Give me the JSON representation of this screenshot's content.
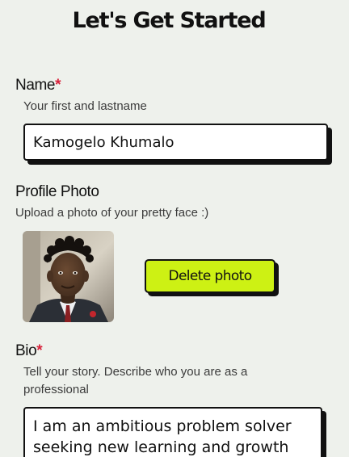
{
  "header": {
    "title": "Let's Get Started"
  },
  "name_field": {
    "label": "Name",
    "required_mark": "*",
    "helper": "Your first and lastname",
    "value": "Kamogelo Khumalo"
  },
  "photo_field": {
    "label": "Profile Photo",
    "helper": "Upload a photo of your pretty face :)",
    "delete_label": "Delete photo",
    "accent_color": "#cdf114"
  },
  "bio_field": {
    "label": "Bio",
    "required_mark": "*",
    "helper": "Tell your story. Describe who you are as a professional",
    "value": "I am an ambitious problem solver seeking new learning and growth"
  },
  "colors": {
    "background": "#eef1ec",
    "required": "#d8223b",
    "border": "#111111"
  }
}
